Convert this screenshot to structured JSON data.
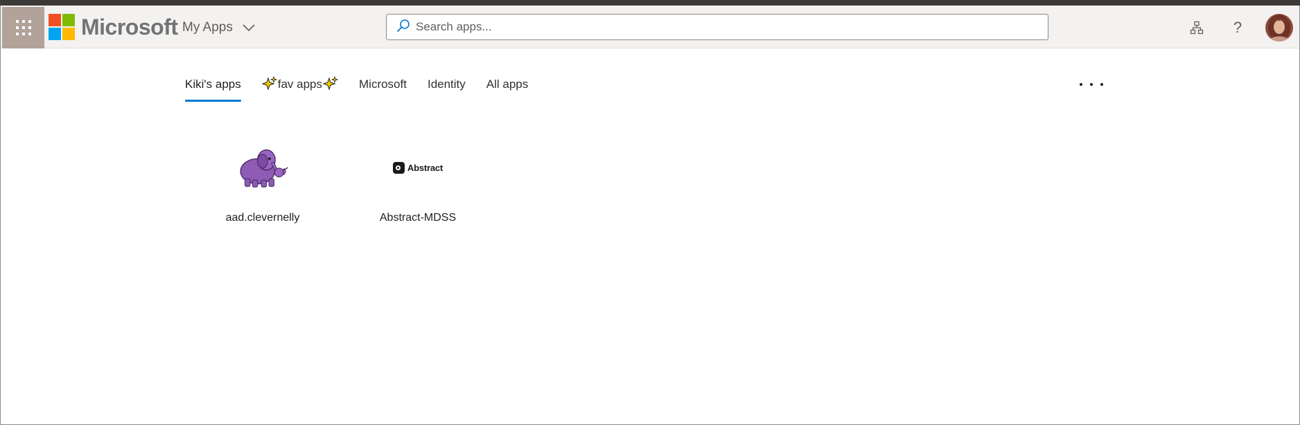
{
  "header": {
    "waffle_icon": "app-launcher-icon",
    "brand": "Microsoft",
    "app_switcher": {
      "label": "My Apps",
      "icon": "chevron-down-icon"
    },
    "search": {
      "placeholder": "Search apps...",
      "value": "",
      "icon": "search-icon"
    },
    "actions": [
      {
        "name": "org-chart-icon"
      },
      {
        "name": "help-icon",
        "glyph": "?"
      }
    ],
    "colors": {
      "header_bg": "#f3f2f1",
      "waffle_bg": "#b1a399",
      "accent": "#0078d4"
    }
  },
  "tabs": [
    {
      "label": "Kiki's apps",
      "active": true
    },
    {
      "label": "fav apps",
      "active": false,
      "decorated": "sparkles-icon"
    },
    {
      "label": "Microsoft",
      "active": false
    },
    {
      "label": "Identity",
      "active": false
    },
    {
      "label": "All apps",
      "active": false
    }
  ],
  "more_icon": "more-horizontal-icon",
  "apps": [
    {
      "name": "aad.clevernelly",
      "logo": "purple-elephant-icon"
    },
    {
      "name": "Abstract-MDSS",
      "logo_text": "Abstract"
    }
  ]
}
